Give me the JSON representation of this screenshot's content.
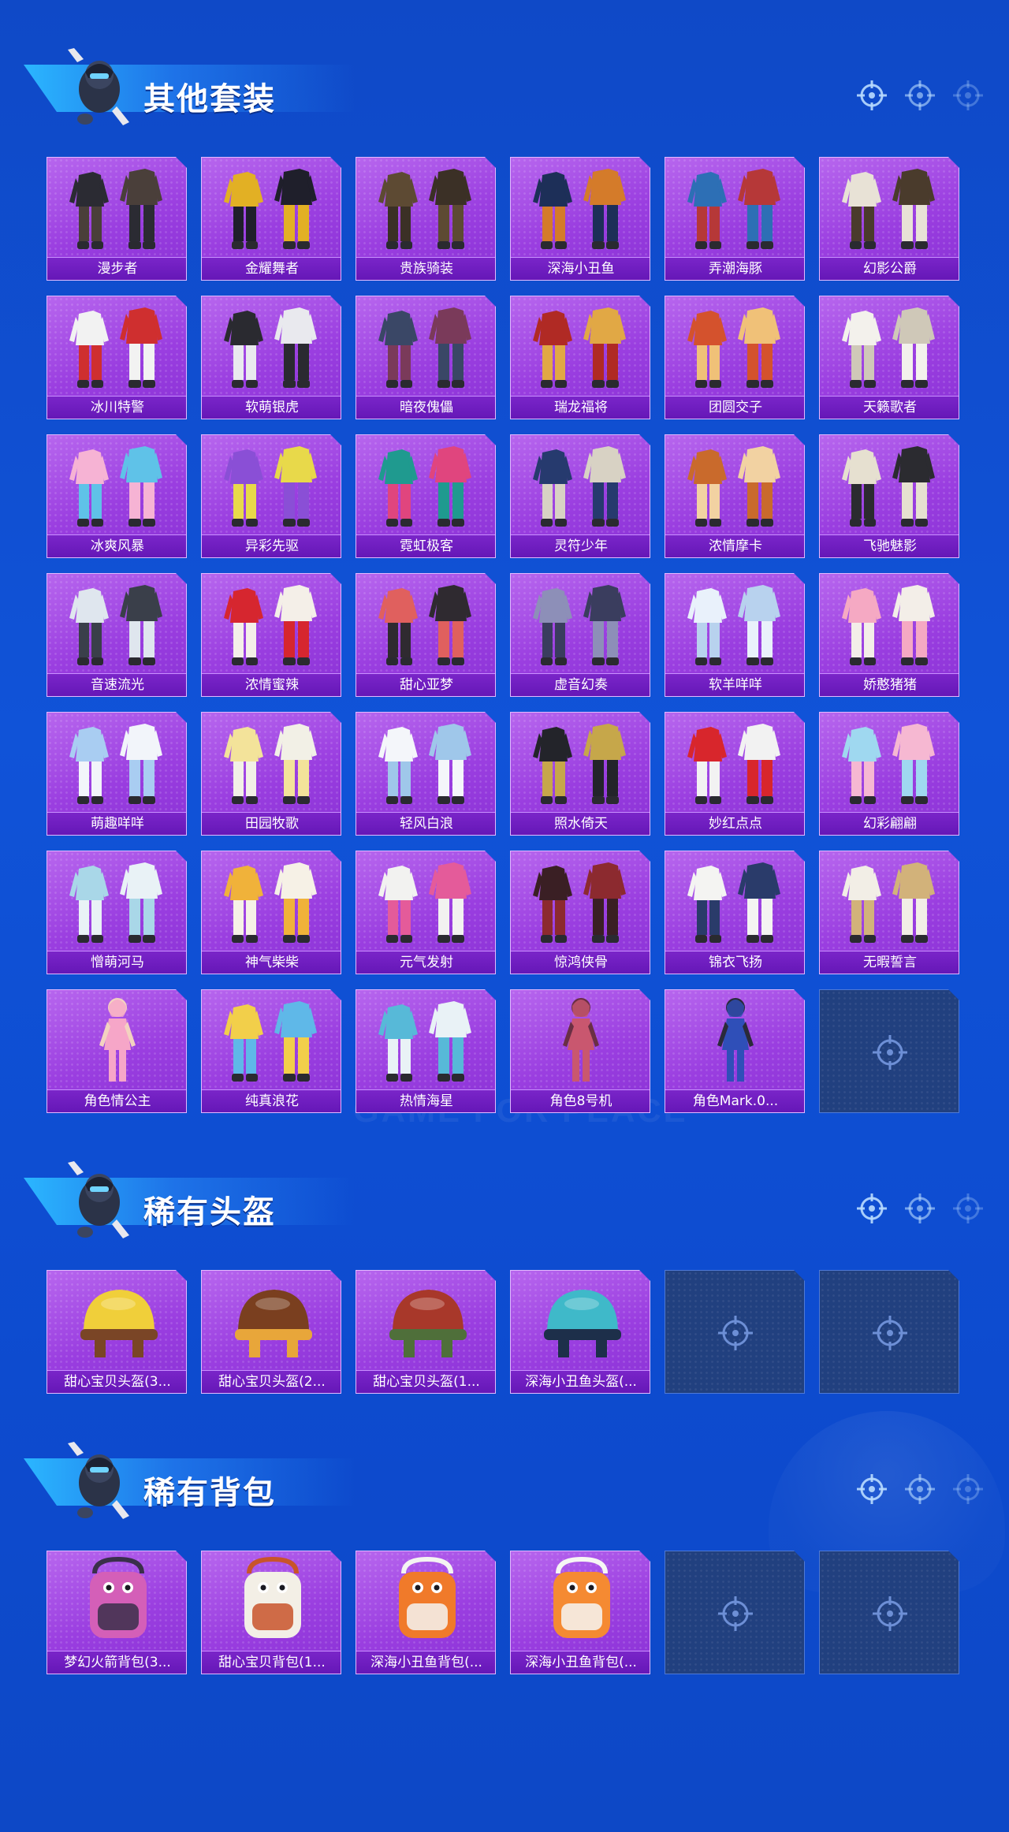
{
  "watermark": "GAME FOR PEACE",
  "icons": {
    "mascot": "soldier-mascot-icon",
    "crosshair": "crosshair-icon",
    "empty_slot": "crosshair-icon"
  },
  "colors": {
    "background": "#0f49c7",
    "card_purple": "#9a3ee0",
    "card_label": "#6b1bbb",
    "empty_slot": "#21407f",
    "header_band": "#2bb6ff"
  },
  "sections": [
    {
      "title": "其他套装",
      "items": [
        {
          "label": "漫步者",
          "art": "outfit",
          "c1": "#2b2b33",
          "c2": "#4a3f3a"
        },
        {
          "label": "金耀舞者",
          "art": "outfit",
          "c1": "#e2b024",
          "c2": "#1f1f2b"
        },
        {
          "label": "贵族骑装",
          "art": "outfit",
          "c1": "#5d4a33",
          "c2": "#3b3026"
        },
        {
          "label": "深海小丑鱼",
          "art": "outfit",
          "c1": "#1d2f58",
          "c2": "#d47b2a"
        },
        {
          "label": "弄潮海豚",
          "art": "outfit",
          "c1": "#2d6fb5",
          "c2": "#b63838"
        },
        {
          "label": "幻影公爵",
          "art": "outfit",
          "c1": "#e8e2d6",
          "c2": "#4a3b2c"
        },
        {
          "label": "冰川特警",
          "art": "outfit",
          "c1": "#f2f2f2",
          "c2": "#cf2f2f"
        },
        {
          "label": "软萌银虎",
          "art": "outfit",
          "c1": "#2a2a30",
          "c2": "#e9e9ee"
        },
        {
          "label": "暗夜傀儡",
          "art": "outfit",
          "c1": "#3a4766",
          "c2": "#7a3a5a"
        },
        {
          "label": "瑞龙福将",
          "art": "outfit",
          "c1": "#b02a24",
          "c2": "#e1a845"
        },
        {
          "label": "团圆交子",
          "art": "outfit",
          "c1": "#d4522d",
          "c2": "#f0c178"
        },
        {
          "label": "天籁歌者",
          "art": "outfit",
          "c1": "#f3f1ec",
          "c2": "#cfc8b8"
        },
        {
          "label": "冰爽风暴",
          "art": "outfit",
          "c1": "#f6b3d4",
          "c2": "#5fc2e8"
        },
        {
          "label": "异彩先驱",
          "art": "outfit",
          "c1": "#8a4fd6",
          "c2": "#e8d94a"
        },
        {
          "label": "霓虹极客",
          "art": "outfit",
          "c1": "#1f9a8f",
          "c2": "#e0457e"
        },
        {
          "label": "灵符少年",
          "art": "outfit",
          "c1": "#263a6e",
          "c2": "#d8d2c4"
        },
        {
          "label": "浓情摩卡",
          "art": "outfit",
          "c1": "#c96a2c",
          "c2": "#f2d2a2"
        },
        {
          "label": "飞驰魅影",
          "art": "outfit",
          "c1": "#e6e0d0",
          "c2": "#2b2b30"
        },
        {
          "label": "音速流光",
          "art": "outfit",
          "c1": "#dfe6ee",
          "c2": "#3a3f4a"
        },
        {
          "label": "浓情蜜辣",
          "art": "outfit",
          "c1": "#d6262f",
          "c2": "#f4efe8"
        },
        {
          "label": "甜心亚梦",
          "art": "outfit",
          "c1": "#e0605e",
          "c2": "#2f2a30"
        },
        {
          "label": "虚音幻奏",
          "art": "outfit",
          "c1": "#8d8fb8",
          "c2": "#3a3d5e"
        },
        {
          "label": "软羊咩咩",
          "art": "outfit",
          "c1": "#e9f1fb",
          "c2": "#b8d2ee"
        },
        {
          "label": "娇憨猪猪",
          "art": "outfit",
          "c1": "#f5a9c3",
          "c2": "#f3eee8"
        },
        {
          "label": "萌趣咩咩",
          "art": "outfit",
          "c1": "#a9cdf2",
          "c2": "#f2f5fa"
        },
        {
          "label": "田园牧歌",
          "art": "outfit",
          "c1": "#f3e39a",
          "c2": "#f2f0e6"
        },
        {
          "label": "轻风白浪",
          "art": "outfit",
          "c1": "#f4f6fa",
          "c2": "#9fc7ea"
        },
        {
          "label": "照水倚天",
          "art": "outfit",
          "c1": "#23242a",
          "c2": "#c6a74a"
        },
        {
          "label": "妙红点点",
          "art": "outfit",
          "c1": "#d8262c",
          "c2": "#f2f2f2"
        },
        {
          "label": "幻彩翩翩",
          "art": "outfit",
          "c1": "#9fd8f0",
          "c2": "#f6b8d2"
        },
        {
          "label": "憎萌河马",
          "art": "outfit",
          "c1": "#a9d7e8",
          "c2": "#e9f2f6"
        },
        {
          "label": "神气柴柴",
          "art": "outfit",
          "c1": "#f0b23a",
          "c2": "#f6f1e6"
        },
        {
          "label": "元气发射",
          "art": "outfit",
          "c1": "#f2f2f0",
          "c2": "#e45b9a"
        },
        {
          "label": "惊鸿侠骨",
          "art": "outfit",
          "c1": "#3a1f24",
          "c2": "#8c2a2f"
        },
        {
          "label": "锦衣飞扬",
          "art": "outfit",
          "c1": "#f4f4f2",
          "c2": "#2a3b6a"
        },
        {
          "label": "无暇誓言",
          "art": "outfit",
          "c1": "#f2eee6",
          "c2": "#d2b27a"
        },
        {
          "label": "角色情公主",
          "art": "character",
          "c1": "#f6a6c8",
          "c2": "#f3d2c0"
        },
        {
          "label": "纯真浪花",
          "art": "outfit",
          "c1": "#f2cf4a",
          "c2": "#5fb8e8"
        },
        {
          "label": "热情海星",
          "art": "outfit",
          "c1": "#57b9d8",
          "c2": "#e9f2f6"
        },
        {
          "label": "角色8号机",
          "art": "character",
          "c1": "#c9576f",
          "c2": "#6a2f44"
        },
        {
          "label": "角色Mark.0...",
          "art": "character",
          "c1": "#2f4fb8",
          "c2": "#2a2a3a"
        },
        {
          "empty": true
        }
      ]
    },
    {
      "title": "稀有头盔",
      "items": [
        {
          "label": "甜心宝贝头盔(3...",
          "art": "helmet",
          "c1": "#f0cf3a",
          "c2": "#7a4526"
        },
        {
          "label": "甜心宝贝头盔(2...",
          "art": "helmet",
          "c1": "#7a3f1f",
          "c2": "#e8a63a"
        },
        {
          "label": "甜心宝贝头盔(1...",
          "art": "helmet",
          "c1": "#a8382a",
          "c2": "#4f6f3a"
        },
        {
          "label": "深海小丑鱼头盔(...",
          "art": "helmet",
          "c1": "#3fb9c9",
          "c2": "#1d2f4a"
        },
        {
          "empty": true
        },
        {
          "empty": true
        }
      ]
    },
    {
      "title": "稀有背包",
      "items": [
        {
          "label": "梦幻火箭背包(3...",
          "art": "backpack",
          "c1": "#d45fb8",
          "c2": "#3a2f4a"
        },
        {
          "label": "甜心宝贝背包(1...",
          "art": "backpack",
          "c1": "#f3efe6",
          "c2": "#c8542a"
        },
        {
          "label": "深海小丑鱼背包(...",
          "art": "backpack",
          "c1": "#f07a2a",
          "c2": "#f4f4f2"
        },
        {
          "label": "深海小丑鱼背包(...",
          "art": "backpack",
          "c1": "#f58a32",
          "c2": "#f6f6f4"
        },
        {
          "empty": true
        },
        {
          "empty": true
        }
      ]
    }
  ]
}
